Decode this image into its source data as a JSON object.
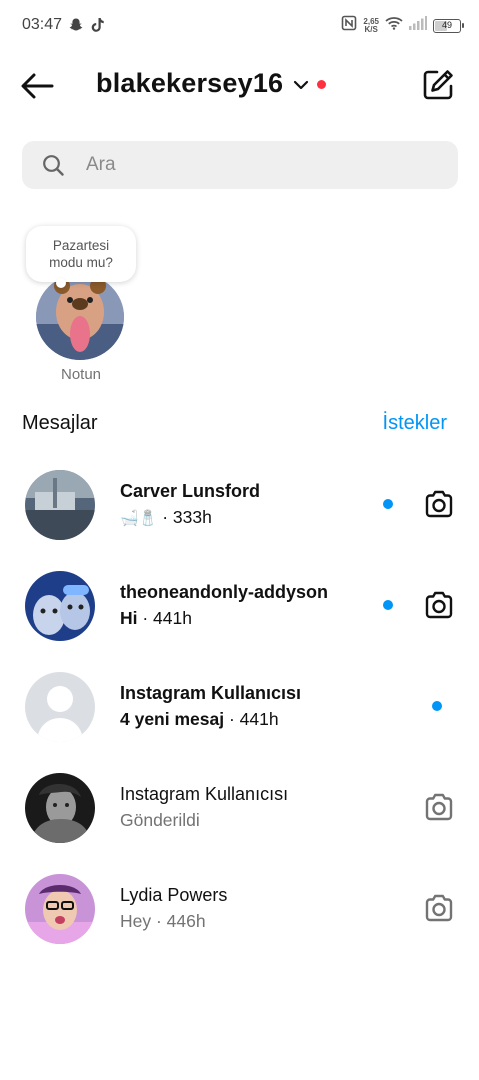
{
  "status_bar": {
    "time": "03:47",
    "speed_value": "2,65",
    "speed_unit": "K/S",
    "battery": "49",
    "battery_level": 0.49,
    "icons": [
      "snapchat-icon",
      "tiktok-icon",
      "nfc-icon",
      "wifi-icon",
      "signal-icon",
      "battery-icon"
    ]
  },
  "header": {
    "username": "blakekersey16",
    "has_notification_dot": true
  },
  "search": {
    "placeholder": "Ara",
    "value": ""
  },
  "note": {
    "text_line1": "Pazartesi",
    "text_line2": "modu mu?",
    "label": "Notun"
  },
  "section": {
    "title": "Mesajlar",
    "requests": "İstekler"
  },
  "threads": [
    {
      "name": "Carver Lunsford",
      "preview_emoji": "🛁🧂",
      "time": " · 333h",
      "unread": true,
      "camera": true
    },
    {
      "name": "theoneandonly-addyson",
      "preview": "Hi",
      "time": " · 441h",
      "unread": true,
      "camera": true
    },
    {
      "name": "Instagram Kullanıcısı",
      "preview": "4 yeni mesaj",
      "time": " · 441h",
      "unread": true,
      "camera": false
    },
    {
      "name": "Instagram Kullanıcısı",
      "preview": "Gönderildi",
      "time": "",
      "unread": false,
      "camera": true
    },
    {
      "name": "Lydia Powers",
      "preview": "Hey",
      "time": " · 446h",
      "unread": false,
      "camera": true
    }
  ],
  "colors": {
    "accent_blue": "#0095f6",
    "notification_red": "#ff3040",
    "search_bg": "#efefef",
    "secondary_text": "#737373"
  }
}
